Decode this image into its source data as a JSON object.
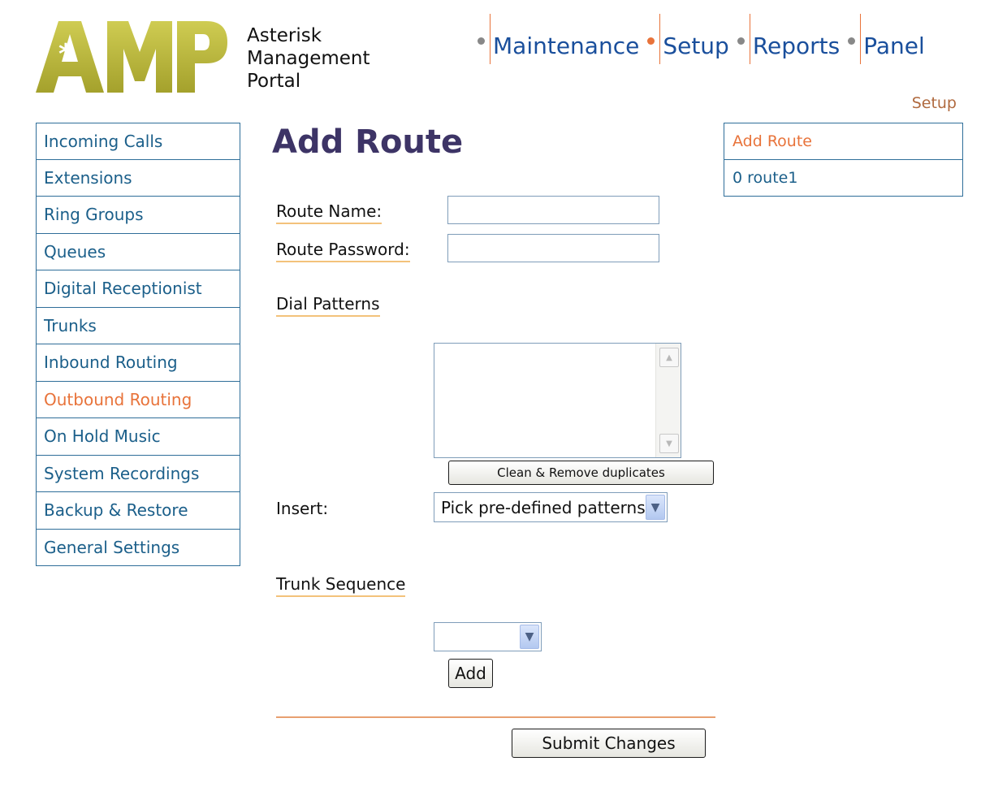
{
  "header": {
    "logo_alt": "AMP",
    "logo_text": [
      "Asterisk",
      "Management",
      "Portal"
    ],
    "nav": [
      {
        "label": "Maintenance",
        "active": false
      },
      {
        "label": "Setup",
        "active": true
      },
      {
        "label": "Reports",
        "active": false
      },
      {
        "label": "Panel",
        "active": false
      }
    ],
    "breadcrumb": "Setup"
  },
  "sidebar": {
    "items": [
      {
        "label": "Incoming Calls"
      },
      {
        "label": "Extensions"
      },
      {
        "label": "Ring Groups"
      },
      {
        "label": "Queues"
      },
      {
        "label": "Digital Receptionist"
      },
      {
        "label": "Trunks"
      },
      {
        "label": "Inbound Routing"
      },
      {
        "label": "Outbound Routing",
        "active": true
      },
      {
        "label": "On Hold Music"
      },
      {
        "label": "System Recordings"
      },
      {
        "label": "Backup & Restore"
      },
      {
        "label": "General Settings"
      }
    ]
  },
  "rightbar": {
    "items": [
      {
        "label": "Add Route"
      },
      {
        "label": "0 route1"
      }
    ]
  },
  "main": {
    "title": "Add Route",
    "route_name_label": "Route Name:",
    "route_name_value": "",
    "route_password_label": "Route Password:",
    "route_password_value": "",
    "dial_patterns_label": "Dial Patterns",
    "dial_patterns_value": "",
    "clean_button": "Clean & Remove duplicates",
    "insert_label": "Insert:",
    "insert_select": "Pick pre-defined patterns",
    "trunk_sequence_label": "Trunk Sequence",
    "trunk_select": "",
    "add_button": "Add",
    "submit_button": "Submit Changes"
  },
  "colors": {
    "accent_orange": "#e8733a",
    "link_blue": "#1a4f9c",
    "sidebar_blue": "#1b5f8a",
    "title_purple": "#3d3466",
    "logo_olive": "#b8b43b"
  }
}
